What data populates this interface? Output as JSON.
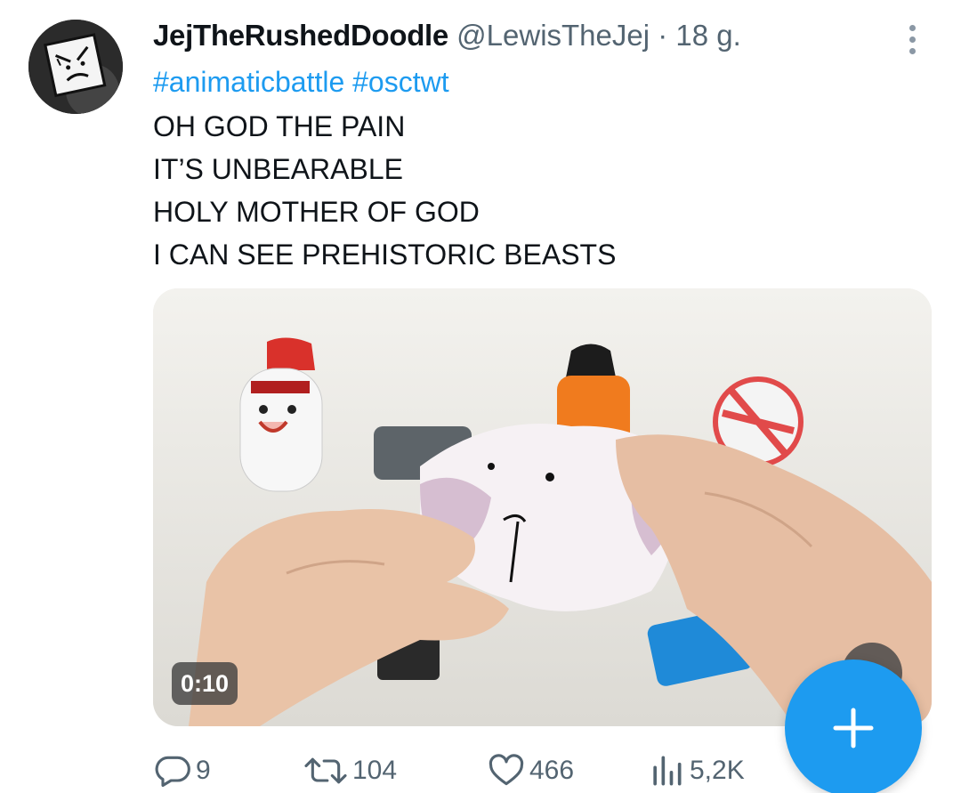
{
  "tweet": {
    "display_name": "JejTheRushedDoodle",
    "handle": "@LewisTheJej",
    "separator": "·",
    "timestamp": "18 g.",
    "hashtags": [
      "#animaticbattle",
      "#osctwt"
    ],
    "text_lines": [
      "OH GOD THE PAIN",
      "IT’S UNBEARABLE",
      "HOLY MOTHER OF GOD",
      "I CAN SEE PREHISTORIC BEASTS"
    ]
  },
  "media": {
    "type": "video",
    "duration": "0:10"
  },
  "actions": {
    "reply": {
      "icon": "reply-icon",
      "count": "9"
    },
    "retweet": {
      "icon": "retweet-icon",
      "count": "104"
    },
    "like": {
      "icon": "heart-icon",
      "count": "466"
    },
    "views": {
      "icon": "views-icon",
      "count": "5,2K"
    }
  },
  "fab": {
    "icon": "plus-icon"
  },
  "colors": {
    "accent": "#1d9bf0",
    "text": "#0f1419",
    "secondary": "#536471"
  }
}
